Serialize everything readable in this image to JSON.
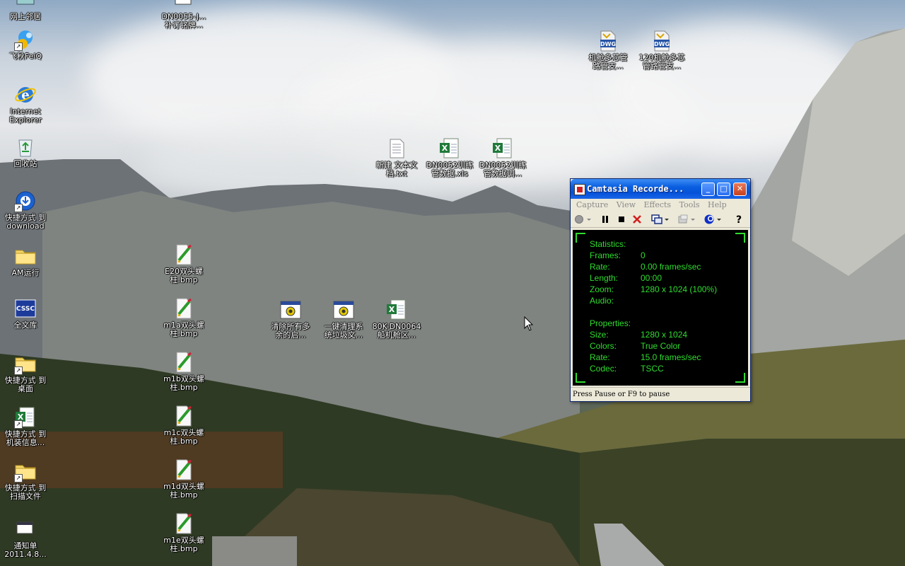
{
  "desktop": {
    "icons": [
      {
        "id": "neighborhood",
        "label": "网上邻居",
        "icon": "network-icon"
      },
      {
        "id": "dn0055",
        "label": "DN0055-J...\n补订铭牌...",
        "icon": "document-icon"
      },
      {
        "id": "feiq",
        "label": "飞秋FeiQ",
        "icon": "feiq-icon"
      },
      {
        "id": "ie",
        "label": "Internet\nExplorer",
        "icon": "ie-icon"
      },
      {
        "id": "recycle",
        "label": "回收站",
        "icon": "recycle-bin-icon"
      },
      {
        "id": "download",
        "label": "快捷方式 到\ndownload",
        "icon": "download-icon"
      },
      {
        "id": "am",
        "label": "AM运行",
        "icon": "folder-icon"
      },
      {
        "id": "wenku",
        "label": "全文库",
        "icon": "cssc-icon"
      },
      {
        "id": "desktop-shortcut",
        "label": "快捷方式 到\n桌面",
        "icon": "folder-icon"
      },
      {
        "id": "machine-info",
        "label": "快捷方式 到\n机装信息...",
        "icon": "excel-icon"
      },
      {
        "id": "scan",
        "label": "快捷方式 到\n扫描文件",
        "icon": "folder-icon"
      },
      {
        "id": "notice",
        "label": "通知单\n2011.4.8...",
        "icon": "document-icon"
      },
      {
        "id": "e20",
        "label": "E20双头螺\n柱.bmp",
        "icon": "bmp-icon"
      },
      {
        "id": "m1a",
        "label": "m1a双头螺\n柱.bmp",
        "icon": "bmp-icon"
      },
      {
        "id": "m1b",
        "label": "m1b双头螺\n柱.bmp",
        "icon": "bmp-icon"
      },
      {
        "id": "m1c",
        "label": "m1c双头螺\n柱.bmp",
        "icon": "bmp-icon"
      },
      {
        "id": "m1d",
        "label": "m1d双头螺\n柱.bmp",
        "icon": "bmp-icon"
      },
      {
        "id": "m1e",
        "label": "m1e双头螺\n柱.bmp",
        "icon": "bmp-icon"
      },
      {
        "id": "clear",
        "label": "清除所有多\n余的启...",
        "icon": "batch-icon"
      },
      {
        "id": "oneclick",
        "label": "一键清理系\n统垃圾文...",
        "icon": "batch-icon"
      },
      {
        "id": "80k",
        "label": "80K-DN0064\n船机舱区...",
        "icon": "excel-icon"
      },
      {
        "id": "newtxt",
        "label": "新建 文本文\n档.txt",
        "icon": "txt-icon"
      },
      {
        "id": "dn0052a",
        "label": "DN0052训练\n管数据.xls",
        "icon": "excel-icon"
      },
      {
        "id": "dn0052b",
        "label": "DN0052训练\n管数据调...",
        "icon": "excel-icon"
      },
      {
        "id": "dwg1",
        "label": "机舱多芯管\n路管支...",
        "icon": "dwg-icon"
      },
      {
        "id": "dwg2",
        "label": "120机舱多芯\n管路管支...",
        "icon": "dwg-icon"
      }
    ]
  },
  "recorder": {
    "title": "Camtasia Recorde...",
    "menu": [
      "Capture",
      "View",
      "Effects",
      "Tools",
      "Help"
    ],
    "stats_header": "Statistics:",
    "stats": [
      {
        "k": "Frames:",
        "v": "0"
      },
      {
        "k": "Rate:",
        "v": "0.00 frames/sec"
      },
      {
        "k": "Length:",
        "v": "00:00"
      },
      {
        "k": "Zoom:",
        "v": "1280 x 1024 (100%)"
      },
      {
        "k": "Audio:",
        "v": ""
      }
    ],
    "props_header": "Properties:",
    "props": [
      {
        "k": "Size:",
        "v": "1280 x 1024"
      },
      {
        "k": "Colors:",
        "v": "True Color"
      },
      {
        "k": "Rate:",
        "v": "15.0 frames/sec"
      },
      {
        "k": "Codec:",
        "v": "TSCC"
      }
    ],
    "status": "Press Pause or F9 to pause",
    "accent": "#2fdc2f"
  }
}
